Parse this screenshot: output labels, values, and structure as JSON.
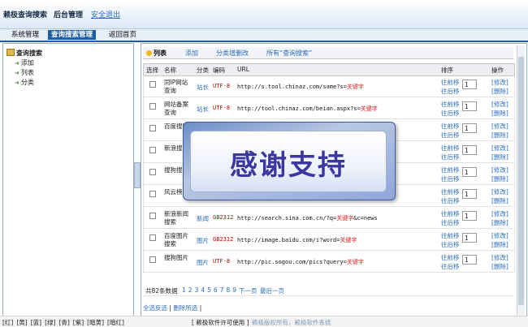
{
  "header": {
    "brand": "赖极查询搜索",
    "manage": "后台管理",
    "logout": "安全退出"
  },
  "menu": {
    "items": [
      {
        "label": "系统管理"
      },
      {
        "label": "查询搜索管理"
      },
      {
        "label": "返回首页"
      }
    ]
  },
  "sidebar": {
    "root": "查询搜索",
    "items": [
      {
        "label": "添加"
      },
      {
        "label": "列表"
      },
      {
        "label": "分类"
      }
    ]
  },
  "tabs": {
    "current": "列表",
    "add": "添加",
    "category": "分类增删改",
    "all": "所有“查询搜索”"
  },
  "table": {
    "headers": [
      "选择",
      "名称",
      "分类",
      "编码",
      "URL",
      "排序",
      "操作"
    ],
    "rows": [
      {
        "name": "同IP网站查询",
        "category": "站长",
        "encoding": "UTF-8",
        "url": "http://s.tool.chinaz.com/same?s=",
        "kw": "关键字",
        "order": "1"
      },
      {
        "name": "网站备案查询",
        "category": "站长",
        "encoding": "UTF-8",
        "url": "http://tool.chinaz.com/beian.aspx?s=",
        "kw": "关键字",
        "order": "1"
      },
      {
        "name": "百度搜索",
        "category": "",
        "encoding": "",
        "url": "",
        "kw": "",
        "order": "1"
      },
      {
        "name": "新浪搜索",
        "category": "",
        "encoding": "",
        "url": "",
        "kw": "",
        "order": "1"
      },
      {
        "name": "搜狗搜索",
        "category": "",
        "encoding": "",
        "url": "",
        "kw": "",
        "order": "1"
      },
      {
        "name": "风云榜",
        "category": "",
        "encoding": "",
        "url": "",
        "kw": "字",
        "order": "1"
      },
      {
        "name": "新浪新闻搜索",
        "category": "新闻",
        "encoding": "GB2312",
        "url": "http://search.sina.com.cn/?q=",
        "kw": "关键字",
        "tail": "&c=news",
        "order": "1"
      },
      {
        "name": "百度图片搜索",
        "category": "图片",
        "encoding": "GB2312",
        "url": "http://image.baidu.com/i?word=",
        "kw": "关键字",
        "order": "1"
      },
      {
        "name": "搜狗图片",
        "category": "图片",
        "encoding": "UTF-8",
        "url": "http://pic.sogou.com/pics?query=",
        "kw": "关键字",
        "order": "1"
      }
    ],
    "move_up": "往前移",
    "move_down": "往后移",
    "edit": "[修改]",
    "delete": "[删除]"
  },
  "pager": {
    "total": "共82条数据",
    "pages": [
      "1",
      "2",
      "3",
      "4",
      "5",
      "6",
      "7",
      "8",
      "9"
    ],
    "next": "下一页",
    "last": "最后一页"
  },
  "actions": {
    "select_all": "全选反选",
    "sep": "|",
    "delete_selected": "删除所选",
    "sep2": "|"
  },
  "footer": {
    "colors": [
      "[红]",
      "[黄]",
      "[蓝]",
      "[绿]",
      "[青]",
      "[紫]",
      "[暗黄]",
      "[暗红]"
    ],
    "license": "[ 赖极软件许可使用 ]",
    "copyright": "赖极版权所有，赖极软件系统"
  },
  "overlay": {
    "text": "感谢支持"
  }
}
